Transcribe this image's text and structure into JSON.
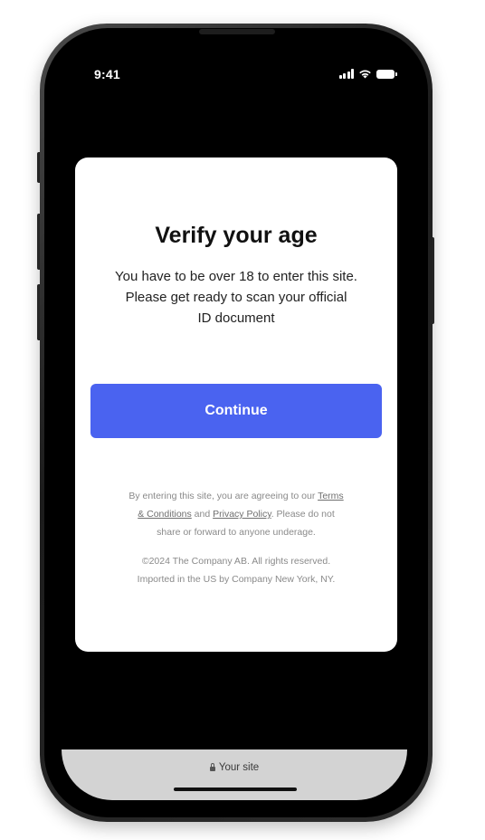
{
  "status_bar": {
    "time": "9:41",
    "icons": [
      "cellular-signal-icon",
      "wifi-icon",
      "battery-icon"
    ]
  },
  "modal": {
    "title": "Verify your age",
    "description_lines": [
      "You have to be over 18 to enter this site.",
      "Please get ready to scan your official",
      "ID document"
    ],
    "continue_label": "Continue",
    "legal": {
      "line1_text": "By entering this site, you are agreeing to our ",
      "terms_link_part1": "Terms",
      "terms_link_part2": "& Conditions",
      "and_text": " and ",
      "privacy_link": "Privacy Policy",
      "line2_tail": ". Please do not",
      "line3": "share or forward to anyone underage."
    },
    "copyright_lines": [
      "©2024 The Company AB. All rights reserved.",
      "Imported in the US by Company New York, NY."
    ]
  },
  "browser": {
    "url_text": "Your site",
    "lock_icon": "lock-icon"
  },
  "colors": {
    "accent": "#4a63f0",
    "screen_background": "#000000",
    "card_background": "#ffffff",
    "browser_bar": "#d3d3d3"
  }
}
